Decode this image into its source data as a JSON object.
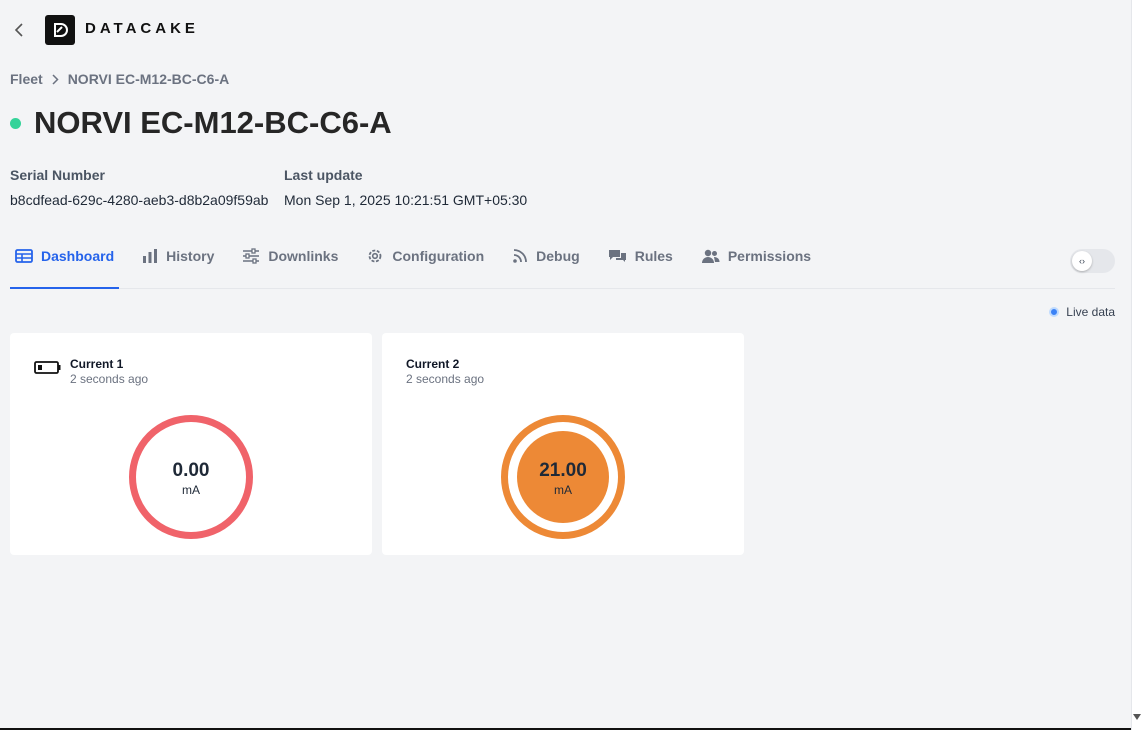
{
  "header": {
    "logo_text": "DATACAKE"
  },
  "breadcrumb": {
    "root": "Fleet",
    "current": "NORVI EC-M12-BC-C6-A"
  },
  "device": {
    "title": "NORVI EC-M12-BC-C6-A",
    "status_color": "#34d399"
  },
  "meta": {
    "serial_label": "Serial Number",
    "serial_value": "b8cdfead-629c-4280-aeb3-d8b2a09f59ab",
    "update_label": "Last update",
    "update_value": "Mon Sep 1, 2025 10:21:51 GMT+05:30"
  },
  "tabs": [
    {
      "label": "Dashboard",
      "icon": "table-icon",
      "active": true
    },
    {
      "label": "History",
      "icon": "bar-chart-icon"
    },
    {
      "label": "Downlinks",
      "icon": "sliders-icon"
    },
    {
      "label": "Configuration",
      "icon": "gear-icon"
    },
    {
      "label": "Debug",
      "icon": "rss-icon"
    },
    {
      "label": "Rules",
      "icon": "chat-icon"
    },
    {
      "label": "Permissions",
      "icon": "users-icon"
    }
  ],
  "toggle": {
    "icon": "code-icon",
    "glyph": "‹›"
  },
  "live": {
    "label": "Live data",
    "color": "#3b82f6"
  },
  "widgets": [
    {
      "name": "Current 1",
      "ago": "2 seconds ago",
      "value": "0.00",
      "unit": "mA",
      "color": "#f0636a",
      "icon": "battery-icon"
    },
    {
      "name": "Current 2",
      "ago": "2 seconds ago",
      "value": "21.00",
      "unit": "mA",
      "color": "#ed8936"
    }
  ]
}
